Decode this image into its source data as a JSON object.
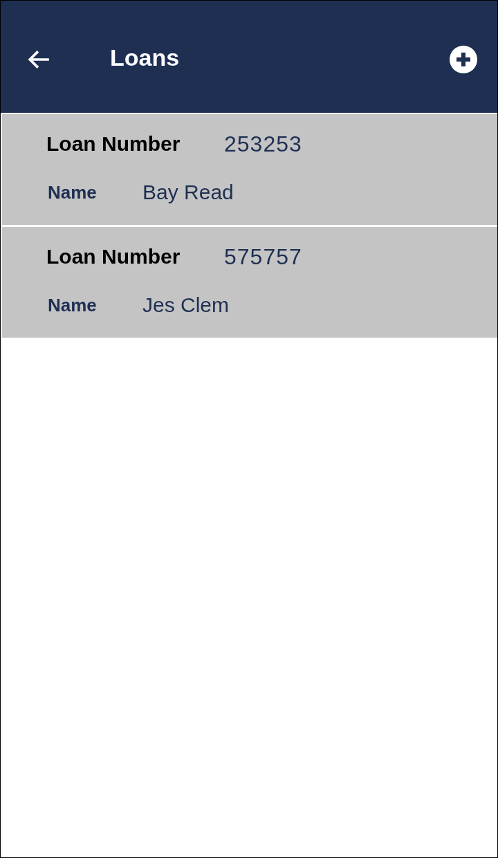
{
  "header": {
    "title": "Loans"
  },
  "loans": [
    {
      "number_label": "Loan Number",
      "number": "253253",
      "name_label": "Name",
      "name": "Bay Read"
    },
    {
      "number_label": "Loan Number",
      "number": "575757",
      "name_label": "Name",
      "name": "Jes Clem"
    }
  ]
}
